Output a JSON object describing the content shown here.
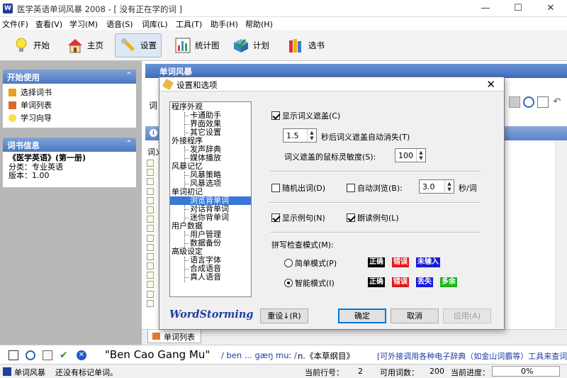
{
  "window": {
    "title": "医学英语单词风暴 2008 - [ 没有正在学的词 ]",
    "app_icon_text": "W"
  },
  "menu": [
    "文件(F)",
    "查看(V)",
    "学习(M)",
    "语音(S)",
    "词库(L)",
    "工具(T)",
    "助手(H)",
    "帮助(H)"
  ],
  "toolbar": {
    "start": "开始",
    "home": "主页",
    "settings": "设置",
    "stats": "统计图",
    "plan": "计划",
    "books": "选书"
  },
  "sidebar": {
    "start_header": "开始使用",
    "start_items": [
      "选择词书",
      "单词列表",
      "学习向导"
    ],
    "info_header": "词书信息",
    "book_title": "《医学英语》(第一册)",
    "category": "分类：专业英语",
    "version": "版本：1.00"
  },
  "workarea": {
    "header": "单词风暴",
    "word_label_fragment": "词",
    "col_label_fragment": "词义",
    "tab_label": "单词列表"
  },
  "bottom": {
    "entry": "\"Ben Cao Gang Mu\"",
    "pron": "/ ben ... gæŋ muː /",
    "defn": "n.《本草纲目》",
    "hint": "[可外接调用各种电子辞典（如金山词霸等）工具来查词"
  },
  "status": {
    "mode": "单词风暴",
    "message": "还没有标记单词。",
    "row_label": "当前行号：",
    "row_value": "2",
    "count_label": "可用词数：",
    "count_value": "200",
    "progress_label": "当前进度：",
    "progress_value": "0%"
  },
  "dialog": {
    "title": "设置和选项",
    "close": "✕",
    "tree": {
      "g1": "程序外观",
      "g1_items": [
        "卡通助手",
        "界面效果",
        "其它设置"
      ],
      "g2": "外接程序",
      "g2_items": [
        "发声辞典",
        "媒体播放"
      ],
      "g3": "风暴记忆",
      "g3_items": [
        "风暴策略",
        "风暴选项"
      ],
      "g4": "单词初记",
      "g4_items": [
        "浏览背单词",
        "对话背单词",
        "迷你背单词"
      ],
      "g5": "用户数据",
      "g5_items": [
        "用户管理",
        "数据备份"
      ],
      "g6": "高级设定",
      "g6_items": [
        "语言字体",
        "合成语音",
        "真人语音"
      ]
    },
    "show_mask": "显示词义遮盖(C)",
    "mask_seconds": "1.5",
    "mask_seconds_label": "秒后词义遮盖自动消失(T)",
    "mouse_sens_label": "词义遮盖的鼠标灵敏度(S):",
    "mouse_sens_value": "100",
    "random_word": "随机出词(D)",
    "auto_browse": "自动浏览(B):",
    "browse_value": "3.0",
    "browse_unit": "秒/词",
    "show_example": "显示例句(N)",
    "read_example": "朗读例句(L)",
    "spell_mode_label": "拼写检查模式(M):",
    "simple_mode": "简单模式(P)",
    "smart_mode": "智能模式(I)",
    "tag_correct": "正确",
    "tag_wrong": "错误",
    "tag_missing": "未输入",
    "tag_lost": "丢失",
    "tag_extra": "多余",
    "brand": "WordStorming",
    "reset_btn": "重设↓(R)",
    "ok_btn": "确定",
    "cancel_btn": "取消",
    "apply_btn": "应用(A)"
  },
  "colors": {
    "accent": "#3a78d6",
    "tag_correct_bg": "#000000",
    "tag_wrong_bg": "#e01b1b",
    "tag_missing_bg": "#1a1adb",
    "tag_extra_bg": "#1fb31f"
  }
}
